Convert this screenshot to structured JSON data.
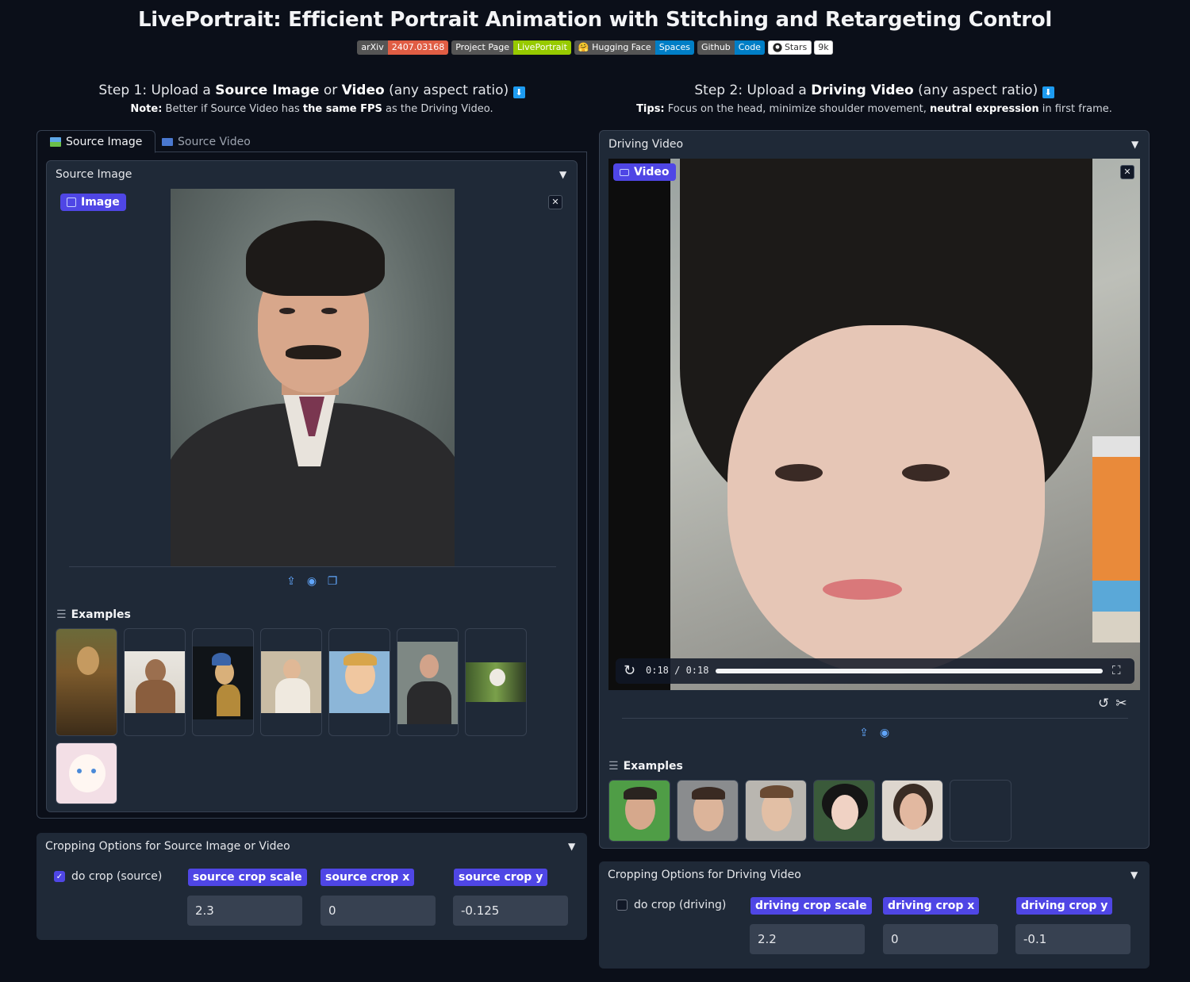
{
  "title": "LivePortrait: Efficient Portrait Animation with Stitching and Retargeting Control",
  "badges": [
    {
      "left": "arXiv",
      "right": "2407.03168",
      "color": "#e05d44"
    },
    {
      "left": "Project Page",
      "right": "LivePortrait",
      "color": "#97ca00"
    },
    {
      "left": "Hugging Face",
      "right": "Spaces",
      "color": "#007ec6"
    },
    {
      "left": "Github",
      "right": "Code",
      "color": "#007ec6"
    }
  ],
  "stars": {
    "label": "Stars",
    "count": "9k"
  },
  "step1": {
    "prefix": "Step 1: Upload a ",
    "b1": "Source Image",
    "mid": " or ",
    "b2": "Video",
    "suffix": " (any aspect ratio)",
    "note_label": "Note:",
    "note_text": " Better if Source Video has ",
    "note_bold": "the same FPS",
    "note_tail": " as the Driving Video."
  },
  "step2": {
    "prefix": "Step 2: Upload a ",
    "b1": "Driving Video",
    "suffix": " (any aspect ratio)",
    "tips_label": "Tips:",
    "tips_text": " Focus on the head, minimize shoulder movement, ",
    "tips_bold": "neutral expression",
    "tips_tail": " in first frame."
  },
  "tabs": {
    "source_image": "Source Image",
    "source_video": "Source Video"
  },
  "source_block": {
    "label": "Source Image",
    "pill": "Image"
  },
  "driving_block": {
    "label": "Driving Video",
    "pill": "Video",
    "time": "0:18 / 0:18",
    "progress": 1.0
  },
  "examples_label": "Examples",
  "crop_source": {
    "title": "Cropping Options for Source Image or Video",
    "checkbox": "do crop (source)",
    "checked": true,
    "fields": [
      {
        "label": "source crop scale",
        "value": "2.3"
      },
      {
        "label": "source crop x",
        "value": "0"
      },
      {
        "label": "source crop y",
        "value": "-0.125"
      }
    ]
  },
  "crop_driving": {
    "title": "Cropping Options for Driving Video",
    "checkbox": "do crop (driving)",
    "checked": false,
    "fields": [
      {
        "label": "driving crop scale",
        "value": "2.2"
      },
      {
        "label": "driving crop x",
        "value": "0"
      },
      {
        "label": "driving crop y",
        "value": "-0.1"
      }
    ]
  },
  "colors": {
    "accent": "#4f46e5",
    "bg": "#0b0f19",
    "panel": "#1f2937"
  }
}
